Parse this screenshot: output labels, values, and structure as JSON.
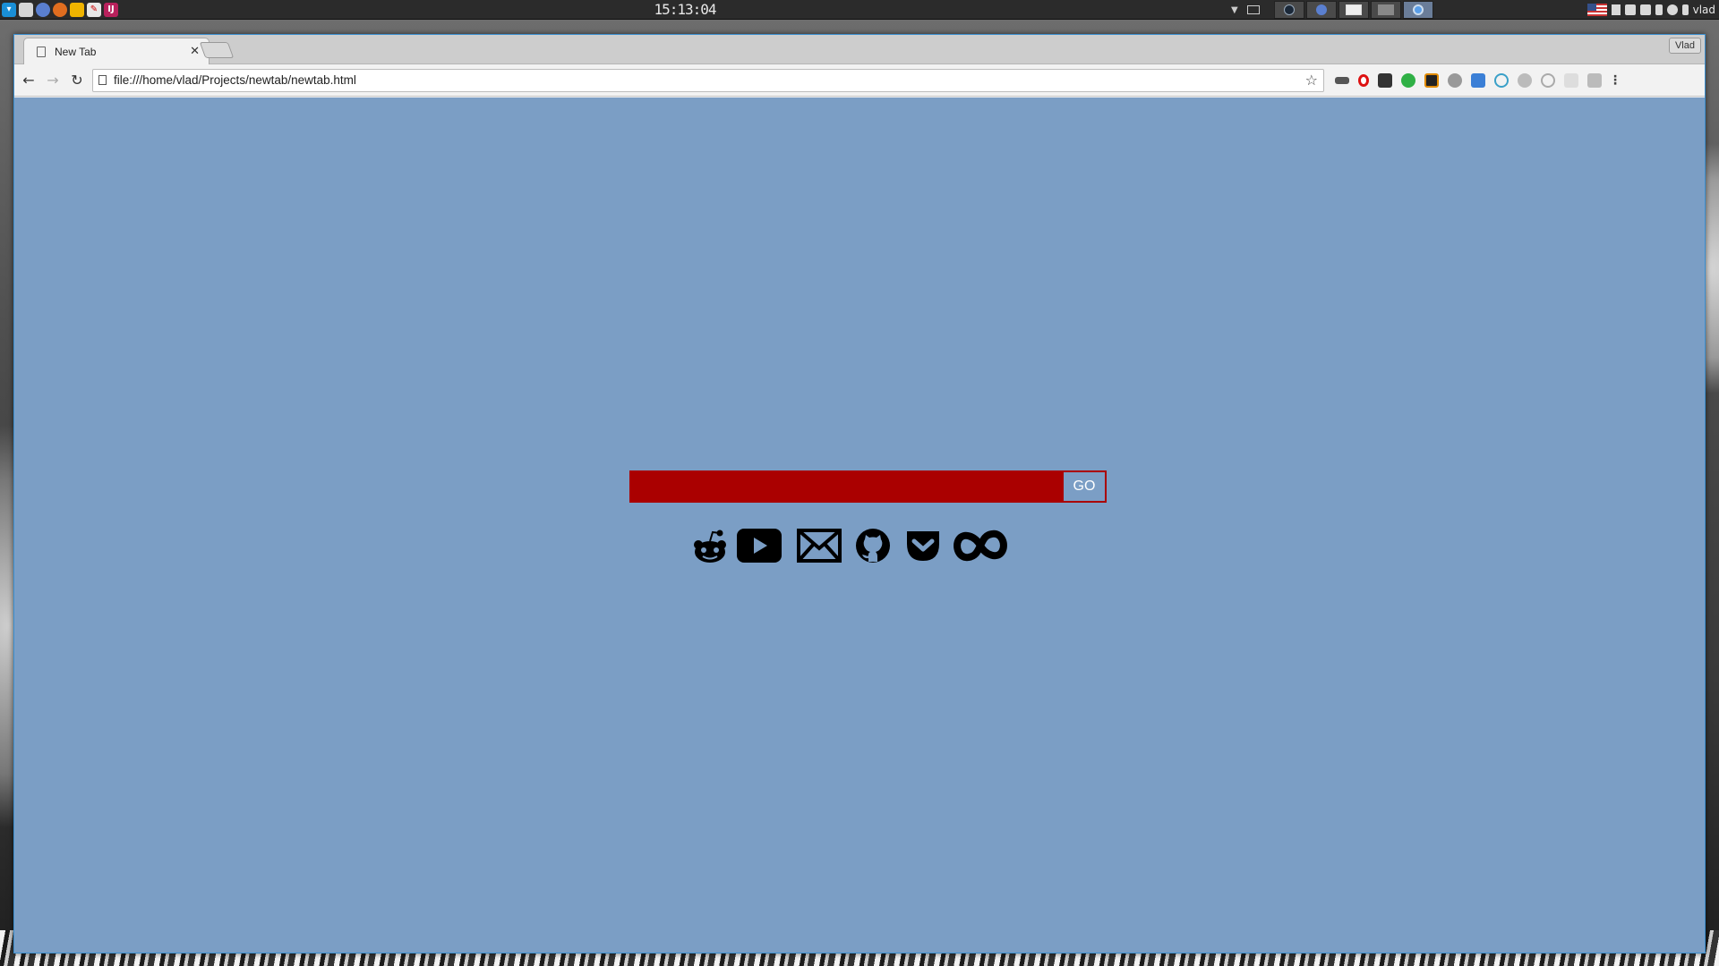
{
  "panel": {
    "clock": "15:13:04",
    "username": "vlad",
    "launchers": [
      "chromium-icon",
      "files-icon",
      "chrome-icon",
      "firefox-icon",
      "security-icon",
      "editor-icon",
      "ide-icon"
    ]
  },
  "browser": {
    "tab": {
      "title": "New Tab"
    },
    "profile_label": "Vlad",
    "url": "file:///home/vlad/Projects/newtab/newtab.html",
    "extensions": [
      "sunglasses-icon",
      "opera-icon",
      "pocket-icon",
      "green-circle-icon",
      "k-icon",
      "checkmark-icon",
      "calendar-icon",
      "crosshair-icon",
      "reddit-ext-icon",
      "search-ext-icon",
      "reader-icon",
      "keyboard-icon"
    ]
  },
  "page": {
    "background": "#7b9ec5",
    "search": {
      "value": "",
      "button_label": "GO",
      "accent": "#aa0000"
    },
    "links": [
      "reddit-icon",
      "youtube-icon",
      "mail-icon",
      "github-icon",
      "pocket-icon",
      "infinity-icon"
    ]
  }
}
